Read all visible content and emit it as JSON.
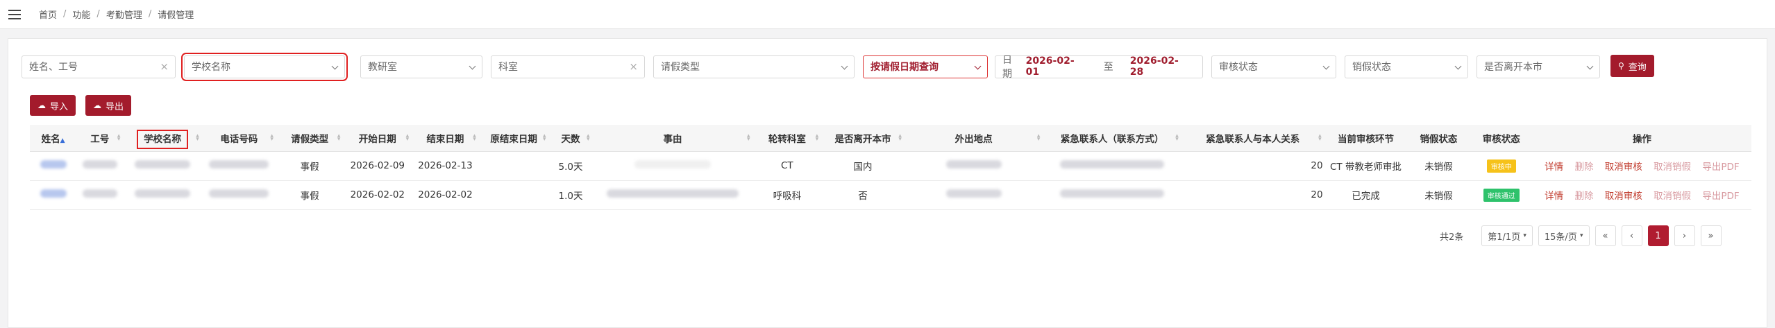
{
  "breadcrumb": [
    "首页",
    "功能",
    "考勤管理",
    "请假管理"
  ],
  "filters": {
    "name_placeholder": "姓名、工号",
    "school_placeholder": "学校名称",
    "dept_placeholder": "教研室",
    "room_placeholder": "科室",
    "leave_type_placeholder": "请假类型",
    "query_mode": "按请假日期查询",
    "date_label": "日期",
    "date_start": "2026-02-01",
    "date_to": "至",
    "date_end": "2026-02-28",
    "audit_status": "审核状态",
    "cancel_status": "销假状态",
    "leave_city": "是否离开本市",
    "query_button": "查询"
  },
  "toolbar": {
    "import_label": "导入",
    "export_label": "导出"
  },
  "table": {
    "headers": [
      "姓名",
      "工号",
      "学校名称",
      "电话号码",
      "请假类型",
      "开始日期",
      "结束日期",
      "原结束日期",
      "天数",
      "事由",
      "轮转科室",
      "是否离开本市",
      "外出地点",
      "紧急联系人（联系方式）",
      "紧急联系人与本人关系",
      "当前审核环节",
      "销假状态",
      "审核状态",
      "操作"
    ],
    "rows": [
      {
        "type": "事假",
        "start": "2026-02-09",
        "end": "2026-02-13",
        "orig_end": "",
        "days": "5.0天",
        "dept": "CT",
        "leave_city": "国内",
        "relation": "20",
        "stage": "CT 带教老师审批",
        "cancel": "未销假",
        "audit": "审核中",
        "audit_color": "#f6c21a"
      },
      {
        "type": "事假",
        "start": "2026-02-02",
        "end": "2026-02-02",
        "orig_end": "",
        "days": "1.0天",
        "dept": "呼吸科",
        "leave_city": "否",
        "relation": "20",
        "stage": "已完成",
        "cancel": "未销假",
        "audit": "审核通过",
        "audit_color": "#2ec26b"
      }
    ],
    "ops": [
      "详情",
      "删除",
      "取消审核",
      "取消销假",
      "导出PDF"
    ]
  },
  "pager": {
    "total": "共2条",
    "page_select": "第1/1页",
    "size_select": "15条/页",
    "first": "«",
    "prev": "‹",
    "current": "1",
    "next": "›",
    "last": "»"
  },
  "colors": {
    "accent": "#a31b2c",
    "highlight": "#e02020"
  }
}
